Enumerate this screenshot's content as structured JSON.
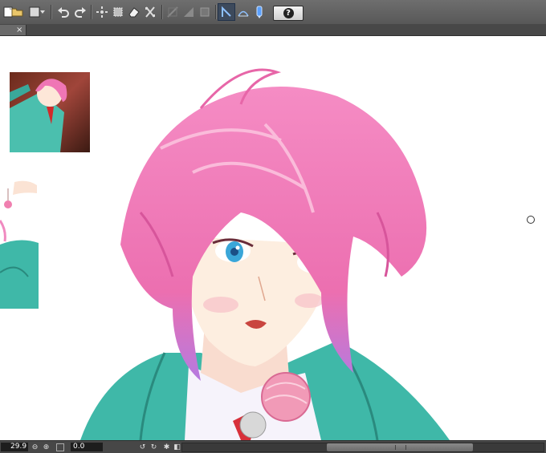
{
  "toolbar": {
    "tools": [
      "new-icon",
      "open-icon",
      "save-icon",
      "dropdown-icon",
      "undo-icon",
      "redo-icon",
      "transform-icon",
      "fill-icon",
      "eraser-icon",
      "crop-icon",
      "ruler-icon",
      "grid-icon",
      "frame-icon",
      "pen-pressure-icon",
      "stabilizer-icon",
      "stylus-icon"
    ],
    "help_label": "?"
  },
  "tabbar": {
    "close_label": "×"
  },
  "status": {
    "zoom_value": "29.9",
    "angle_value": "0.0"
  },
  "colors": {
    "hair": "#f07fb8",
    "hair_shadow": "#d7559b",
    "hair_tip": "#b17adb",
    "jacket": "#3fb8a8",
    "skin": "#fdeee0",
    "eyes": "#3aa6d8",
    "ribbon": "#d8303a",
    "lollipop": "#f19ab7"
  }
}
